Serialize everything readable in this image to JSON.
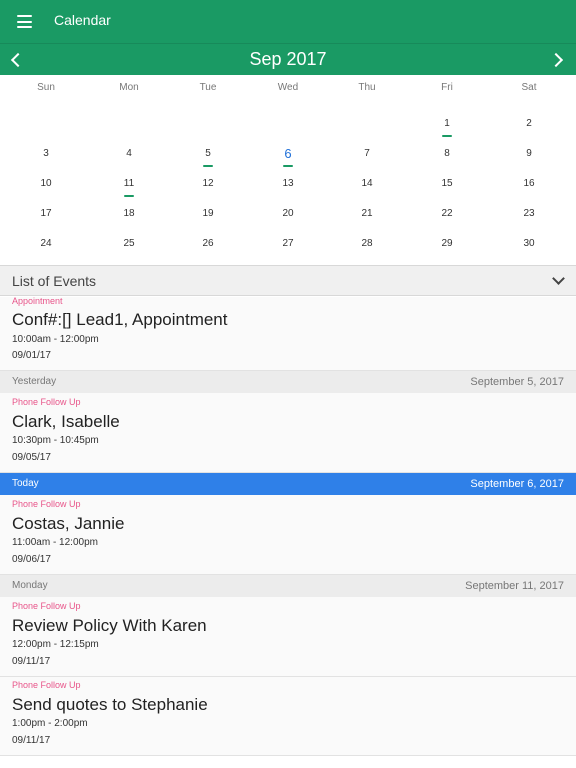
{
  "app": {
    "title": "Calendar"
  },
  "calendar": {
    "month_label": "Sep 2017",
    "weekdays": [
      "Sun",
      "Mon",
      "Tue",
      "Wed",
      "Thu",
      "Fri",
      "Sat"
    ],
    "today": "6",
    "event_days": [
      "1",
      "5",
      "6",
      "11"
    ],
    "weeks": [
      [
        "",
        "",
        "",
        "",
        "",
        "1",
        "2"
      ],
      [
        "3",
        "4",
        "5",
        "6",
        "7",
        "8",
        "9"
      ],
      [
        "10",
        "11",
        "12",
        "13",
        "14",
        "15",
        "16"
      ],
      [
        "17",
        "18",
        "19",
        "20",
        "21",
        "22",
        "23"
      ],
      [
        "24",
        "25",
        "26",
        "27",
        "28",
        "29",
        "30"
      ]
    ]
  },
  "events_header": {
    "title": "List of Events"
  },
  "events": [
    {
      "type": "Appointment",
      "title": "Conf#:[] Lead1, Appointment",
      "time": "10:00am - 12:00pm",
      "date": "09/01/17"
    },
    {
      "type": "Phone Follow Up",
      "title": "Clark, Isabelle",
      "time": "10:30pm - 10:45pm",
      "date": "09/05/17"
    },
    {
      "type": "Phone Follow Up",
      "title": "Costas, Jannie",
      "time": "11:00am - 12:00pm",
      "date": "09/06/17"
    },
    {
      "type": "Phone Follow Up",
      "title": "Review Policy With Karen",
      "time": "12:00pm - 12:15pm",
      "date": "09/11/17"
    },
    {
      "type": "Phone Follow Up",
      "title": "Send quotes to Stephanie",
      "time": "1:00pm - 2:00pm",
      "date": "09/11/17"
    }
  ],
  "sections": [
    {
      "label": "Yesterday",
      "date": "September 5, 2017"
    },
    {
      "label": "Today",
      "date": "September 6, 2017"
    },
    {
      "label": "Monday",
      "date": "September 11, 2017"
    }
  ],
  "colors": {
    "primary": "#1a9a64",
    "today_highlight": "#2f80e8",
    "event_type": "#e8558a",
    "today_date_text": "#1e6fd8"
  }
}
